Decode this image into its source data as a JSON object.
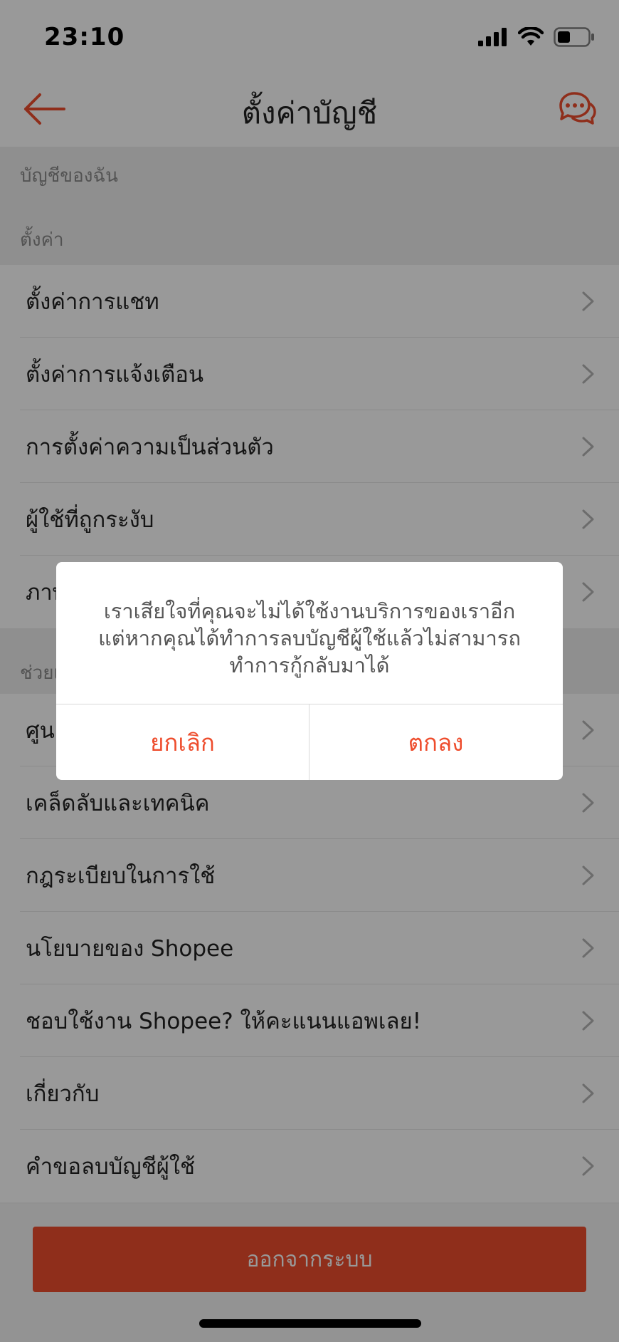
{
  "status_bar": {
    "time": "23:10"
  },
  "nav": {
    "title": "ตั้งค่าบัญชี"
  },
  "sections": {
    "my_account": "บัญชีของฉัน",
    "settings": "ตั้งค่า",
    "help": "ช่วยเหลือ"
  },
  "settings_items": [
    "ตั้งค่าการแชท",
    "ตั้งค่าการแจ้งเตือน",
    "การตั้งค่าความเป็นส่วนตัว",
    "ผู้ใช้ที่ถูกระงับ",
    "ภาษา"
  ],
  "help_items": [
    "ศูนย์ช่วยเหลือ",
    "เคล็ดลับและเทคนิค",
    "กฎระเบียบในการใช้",
    "นโยบายของ Shopee",
    "ชอบใช้งาน Shopee? ให้คะแนนแอพเลย!",
    "เกี่ยวกับ",
    "คำขอลบบัญชีผู้ใช้"
  ],
  "footer": {
    "logout_label": "ออกจากระบบ"
  },
  "dialog": {
    "message_lines": [
      "เราเสียใจที่คุณจะไม่ได้ใช้งานบริการของเราอีก",
      "แต่หากคุณได้ทำการลบบัญชีผู้ใช้แล้วไม่สามารถ",
      "ทำการกู้กลับมาได้"
    ],
    "cancel_label": "ยกเลิก",
    "ok_label": "ตกลง"
  },
  "colors": {
    "brand": "#ee4d2d",
    "overlay": "rgba(0,0,0,0.4)"
  },
  "icons": [
    "back-arrow-icon",
    "chat-icon",
    "chevron-right-icon",
    "signal-icon",
    "wifi-icon",
    "battery-icon"
  ]
}
